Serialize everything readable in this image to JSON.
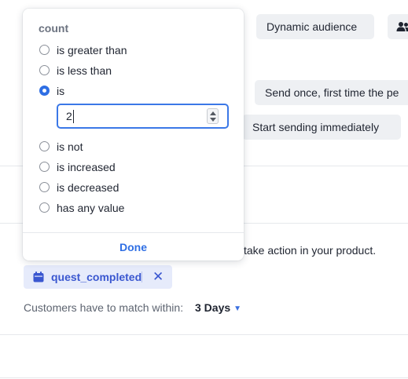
{
  "toolbar": {
    "dynamic_audience_label": "Dynamic audience",
    "send_once_label": "Send once, first time the pe",
    "start_sending_label": "Start sending immediately"
  },
  "trigger": {
    "description": "take action in your product.",
    "event_name": "quest_completed",
    "match_label": "Customers have to match within:",
    "match_value": "3 Days"
  },
  "popover": {
    "heading": "count",
    "options": [
      {
        "label": "is greater than",
        "selected": false
      },
      {
        "label": "is less than",
        "selected": false
      },
      {
        "label": "is",
        "selected": true
      },
      {
        "label": "is not",
        "selected": false
      },
      {
        "label": "is increased",
        "selected": false
      },
      {
        "label": "is decreased",
        "selected": false
      },
      {
        "label": "has any value",
        "selected": false
      }
    ],
    "input_value": "2",
    "done_label": "Done"
  },
  "colors": {
    "accent": "#2f6fe4",
    "chip_bg": "#eef0f3",
    "tag_bg": "#e6ebfb",
    "tag_text": "#3a57d0"
  }
}
